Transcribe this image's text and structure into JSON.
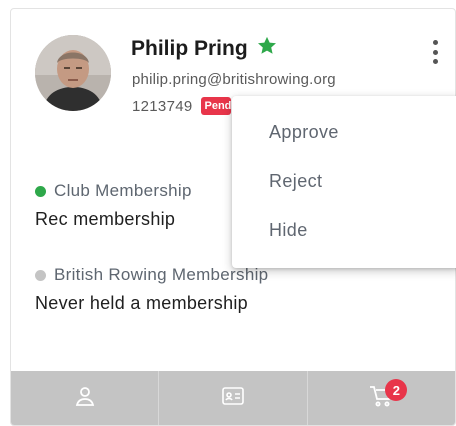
{
  "member": {
    "name": "Philip Pring",
    "email": "philip.pring@britishrowing.org",
    "member_id": "1213749",
    "status_badge": "Pending"
  },
  "memberships": [
    {
      "type": "Club Membership",
      "status": "Rec membership",
      "dot_color": "#2ea84a"
    },
    {
      "type": "British Rowing Membership",
      "status": "Never held a membership",
      "dot_color": "#c4c4c4"
    }
  ],
  "context_menu": {
    "items": [
      "Approve",
      "Reject",
      "Hide"
    ]
  },
  "footer": {
    "tabs": [
      "profile-icon",
      "id-card-icon",
      "cart-icon"
    ],
    "cart_count": "2"
  },
  "icons": {
    "star": "star-icon",
    "menu": "kebab-menu-icon"
  },
  "colors": {
    "accent_green": "#2ea84a",
    "badge_red": "#e8354a",
    "footer_bg": "#c4c4c4"
  }
}
